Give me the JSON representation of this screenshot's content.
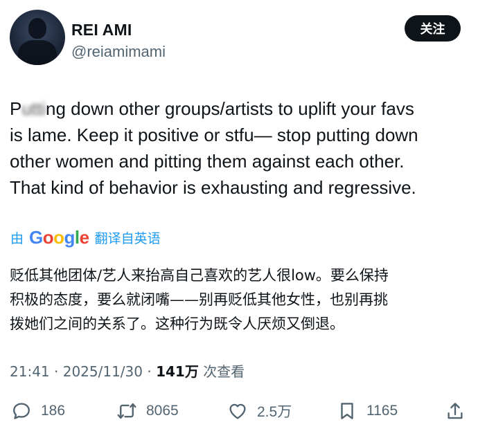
{
  "author": {
    "display_name": "REI AMI",
    "handle": "@reiamimami",
    "avatar_icon": "avatar-silhouette"
  },
  "follow_button": {
    "label": "关注"
  },
  "post": {
    "text_lines": [
      {
        "start": "P",
        "blurred": "utti",
        "rest": "ng down other groups/artists to uplift your favs"
      },
      "is lame. Keep it positive or stfu— stop putting down",
      "other women and pitting them against each other.",
      "That kind of behavior is exhausting and regressive."
    ]
  },
  "translation": {
    "by_label": "由",
    "provider_letters": [
      "G",
      "o",
      "o",
      "g",
      "l",
      "e"
    ],
    "from_label": "翻译自英语",
    "text_lines": [
      "贬低其他团体/艺人来抬高自己喜欢的艺人很low。要么保持",
      "积极的态度，要么就闭嘴——别再贬低其他女性，也别再挑",
      "拨她们之间的关系了。这种行为既令人厌烦又倒退。"
    ]
  },
  "meta": {
    "time": "21:41",
    "separator": "·",
    "date": "2025/11/30",
    "views": "141万",
    "views_label": "次查看"
  },
  "actions": {
    "replies": "186",
    "reposts": "8065",
    "likes": "2.5万",
    "bookmarks": "1165"
  },
  "colors": {
    "accent": "#1d9bf0",
    "muted": "#536471",
    "text": "#0f1419",
    "button": "#0f1419"
  }
}
